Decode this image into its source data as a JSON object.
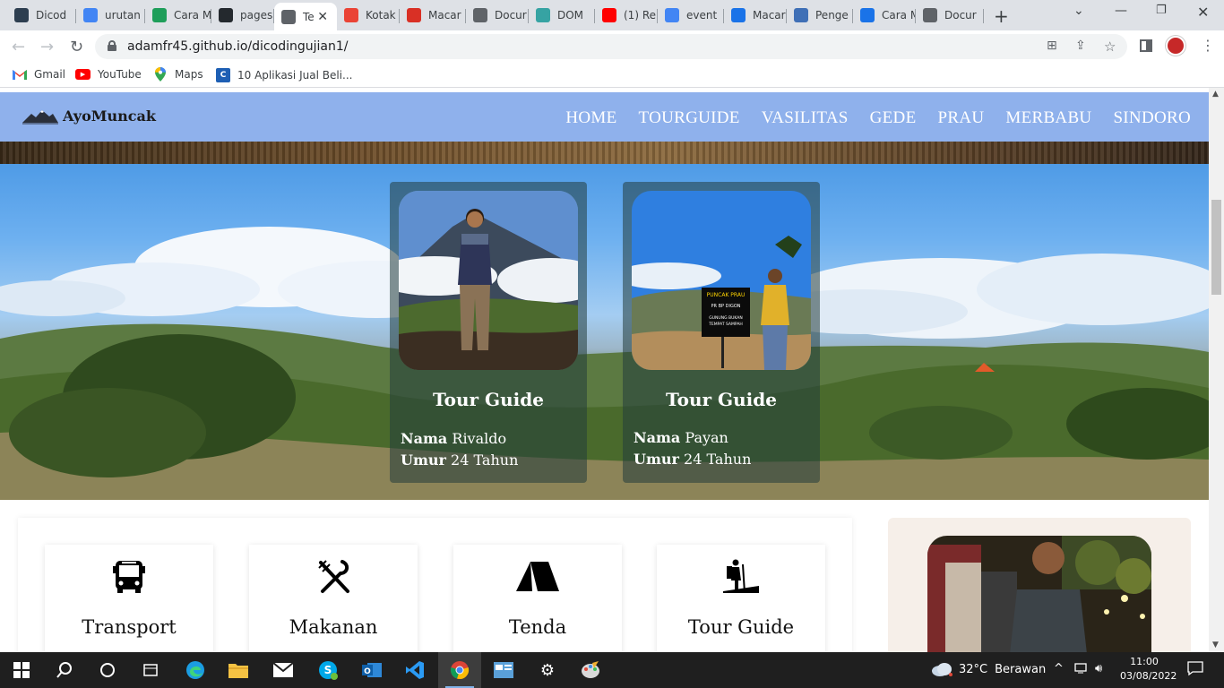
{
  "browser": {
    "tabs": [
      {
        "title": "Dicod",
        "favicon": "dicoding",
        "color": "#2d3e50"
      },
      {
        "title": "urutan",
        "favicon": "google",
        "color": "#4285f4"
      },
      {
        "title": "Cara M",
        "favicon": "docs-3",
        "color": "#1e9e5a"
      },
      {
        "title": "pages",
        "favicon": "github",
        "color": "#24292e"
      },
      {
        "title": "Te",
        "favicon": "globe",
        "color": "#5f6368",
        "active": true
      },
      {
        "title": "Kotak",
        "favicon": "gmail",
        "color": "#ea4335"
      },
      {
        "title": "Macar",
        "favicon": "tokopedia-t",
        "color": "#d93025"
      },
      {
        "title": "Docur",
        "favicon": "globe",
        "color": "#5f6368"
      },
      {
        "title": "DOM",
        "favicon": "dom",
        "color": "#36a3a3"
      },
      {
        "title": "(1) Re",
        "favicon": "youtube",
        "color": "#ff0000"
      },
      {
        "title": "event",
        "favicon": "google",
        "color": "#4285f4"
      },
      {
        "title": "Macar",
        "favicon": "macar",
        "color": "#1a73e8"
      },
      {
        "title": "Penge",
        "favicon": "pengenalan",
        "color": "#3f6fb6"
      },
      {
        "title": "Cara M",
        "favicon": "cara",
        "color": "#1a73e8"
      },
      {
        "title": "Docur",
        "favicon": "globe",
        "color": "#5f6368"
      }
    ],
    "url": "adamfr45.github.io/dicodingujian1/",
    "bookmarks": [
      {
        "label": "Gmail",
        "icon": "gmail-icon"
      },
      {
        "label": "YouTube",
        "icon": "youtube-icon"
      },
      {
        "label": "Maps",
        "icon": "maps-icon"
      },
      {
        "label": "10 Aplikasi Jual Beli...",
        "icon": "bookmark-site-icon"
      }
    ]
  },
  "site": {
    "brand": "AyoMuncak",
    "menu": [
      "HOME",
      "TOURGUIDE",
      "VASILITAS",
      "GEDE",
      "PRAU",
      "MERBABU",
      "SINDORO"
    ],
    "guides": [
      {
        "title": "Tour Guide",
        "name_label": "Nama",
        "name": "Rivaldo",
        "age_label": "Umur",
        "age": "24 Tahun"
      },
      {
        "title": "Tour Guide",
        "name_label": "Nama",
        "name": "Payan",
        "age_label": "Umur",
        "age": "24 Tahun"
      }
    ],
    "guide2_sign": {
      "line1": "PUNCAK PRAU",
      "line2": "PR BP DIGON",
      "line3": "GUNUNG BUKAN",
      "line4": "TEMPAT SAMPAH"
    },
    "services": [
      {
        "label": "Transport",
        "icon": "bus-icon"
      },
      {
        "label": "Makanan",
        "icon": "fork-knife-icon"
      },
      {
        "label": "Tenda",
        "icon": "tent-icon"
      },
      {
        "label": "Tour Guide",
        "icon": "hiker-icon"
      }
    ]
  },
  "taskbar": {
    "weather_temp": "32°C",
    "weather_text": "Berawan",
    "time": "11:00",
    "date": "03/08/2022"
  }
}
